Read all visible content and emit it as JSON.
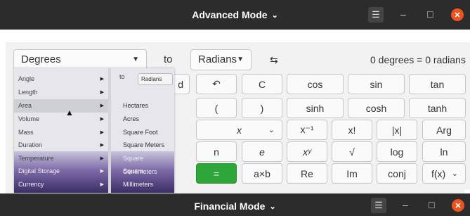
{
  "window_top": {
    "title": "Advanced Mode",
    "chevron": "⌄",
    "menu_icon": "☰",
    "minimize_icon": "–",
    "maximize_icon": "□",
    "close_icon": "✕"
  },
  "window_bottom": {
    "title": "Financial Mode",
    "chevron": "⌄",
    "menu_icon": "☰",
    "minimize_icon": "–",
    "maximize_icon": "□",
    "close_icon": "✕"
  },
  "converter": {
    "from_unit": "Degrees",
    "to_label": "to",
    "to_unit": "Radians",
    "swap_icon": "⇆",
    "result": "0 degrees = 0 radians"
  },
  "keypad": {
    "row1": [
      "d",
      "↶",
      "C",
      "cos",
      "sin",
      "tan"
    ],
    "row2": [
      "(",
      ")",
      "sinh",
      "cosh",
      "tanh"
    ],
    "row3": [
      "x",
      "x⁻¹",
      "x!",
      "|x|",
      "Arg"
    ],
    "row4": [
      "n",
      "e",
      "xʸ",
      "√",
      "log",
      "ln"
    ],
    "row5": [
      "=",
      "a×b",
      "Re",
      "Im",
      "conj",
      "f(x)"
    ]
  },
  "unit_menu": {
    "categories": [
      "Angle",
      "Length",
      "Area",
      "Volume",
      "Mass",
      "Duration",
      "Temperature",
      "Digital Storage",
      "Currency"
    ],
    "selected_category": "Area",
    "to_label": "to",
    "to_unit": "Radians",
    "area_units": [
      "Hectares",
      "Acres",
      "Square Foot",
      "Square Meters",
      "Square Centimeters",
      "Square Millimeters"
    ]
  },
  "colors": {
    "titlebar": "#2c2c2c",
    "close": "#e9541f",
    "equals": "#2fa63a"
  }
}
